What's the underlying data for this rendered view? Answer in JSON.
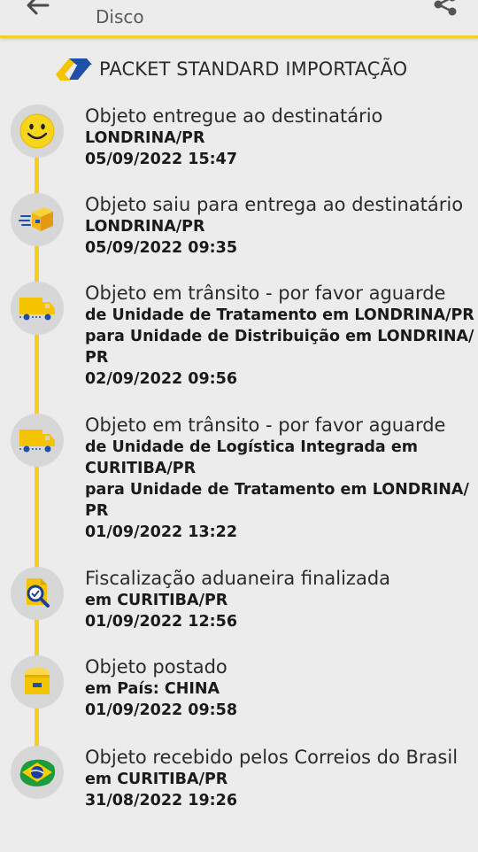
{
  "header": {
    "subtitle": "Disco",
    "back_icon": "arrow-left-icon",
    "share_icon": "share-icon",
    "accent_color": "#f2cf2a"
  },
  "service": {
    "logo": "correios-logo",
    "name": "PACKET STANDARD IMPORTAÇÃO"
  },
  "timeline_color": "#f5cf1d",
  "events": [
    {
      "icon": "smiley-icon",
      "title": "Objeto entregue ao destinatário",
      "lines": [
        "LONDRINA/PR"
      ],
      "datetime": "05/09/2022 15:47"
    },
    {
      "icon": "delivery-box-icon",
      "title": "Objeto saiu para entrega ao destinatário",
      "lines": [
        "LONDRINA/PR"
      ],
      "datetime": "05/09/2022 09:35"
    },
    {
      "icon": "truck-icon",
      "title": "Objeto em trânsito - por favor aguarde",
      "lines": [
        "de Unidade de Tratamento em LONDRINA/PR",
        "para Unidade de Distribuição em LONDRINA/",
        "PR"
      ],
      "datetime": "02/09/2022 09:56"
    },
    {
      "icon": "truck-icon",
      "title": "Objeto em trânsito - por favor aguarde",
      "lines": [
        "de Unidade de Logística Integrada em",
        "CURITIBA/PR",
        "para Unidade de Tratamento em LONDRINA/",
        "PR"
      ],
      "datetime": "01/09/2022 13:22"
    },
    {
      "icon": "customs-inspection-icon",
      "title": "Fiscalização aduaneira finalizada",
      "lines": [
        "em CURITIBA/PR"
      ],
      "datetime": "01/09/2022 12:56"
    },
    {
      "icon": "mailbox-icon",
      "title": "Objeto postado",
      "lines": [
        "em País: CHINA"
      ],
      "datetime": "01/09/2022 09:58"
    },
    {
      "icon": "brazil-flag-icon",
      "title": "Objeto recebido pelos Correios do Brasil",
      "lines": [
        "em CURITIBA/PR"
      ],
      "datetime": "31/08/2022 19:26"
    }
  ]
}
